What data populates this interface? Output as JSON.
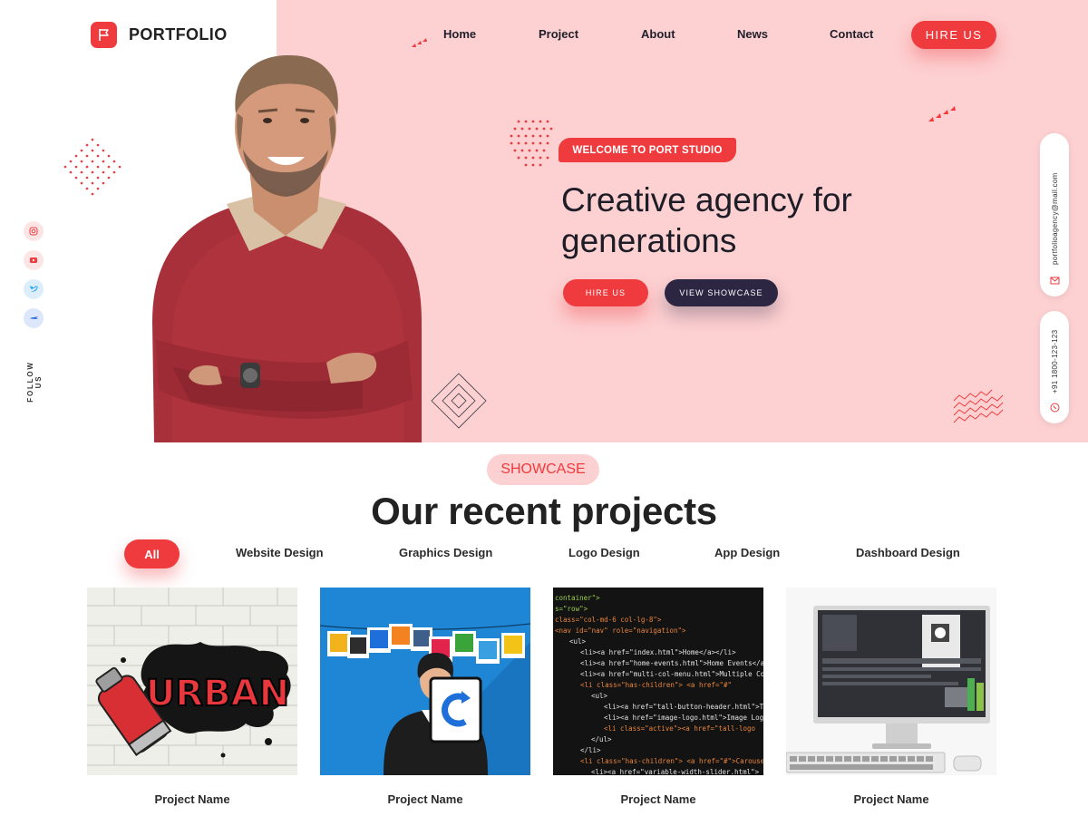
{
  "brand": {
    "name": "PORTFOLIO",
    "logo_icon": "flag-icon",
    "accent": "#ef3a3e",
    "pink": "#fdd0d1",
    "dark": "#2c2643"
  },
  "nav": {
    "items": [
      {
        "label": "Home"
      },
      {
        "label": "Project"
      },
      {
        "label": "About"
      },
      {
        "label": "News"
      },
      {
        "label": "Contact"
      }
    ],
    "hire_label": "HIRE US"
  },
  "hero": {
    "tag": "WELCOME TO PORT STUDIO",
    "headline": "Creative agency for generations",
    "primary_cta": "HIRE US",
    "secondary_cta": "VIEW SHOWCASE"
  },
  "social": {
    "follow_label": "FOLLOW US",
    "icons": [
      "instagram-icon",
      "youtube-icon",
      "twitter-icon",
      "facebook-icon"
    ]
  },
  "contact": {
    "email": "portfolioagency@mail.com",
    "phone": "+91 1800-123-123"
  },
  "showcase": {
    "badge": "SHOWCASE",
    "title": "Our recent projects",
    "filters": [
      "All",
      "Website Design",
      "Graphics Design",
      "Logo Design",
      "App Design",
      "Dashboard Design"
    ],
    "active_filter": "All",
    "projects": [
      {
        "name": "Project Name",
        "thumb_text": "URBAN"
      },
      {
        "name": "Project Name"
      },
      {
        "name": "Project Name"
      },
      {
        "name": "Project Name"
      }
    ]
  }
}
